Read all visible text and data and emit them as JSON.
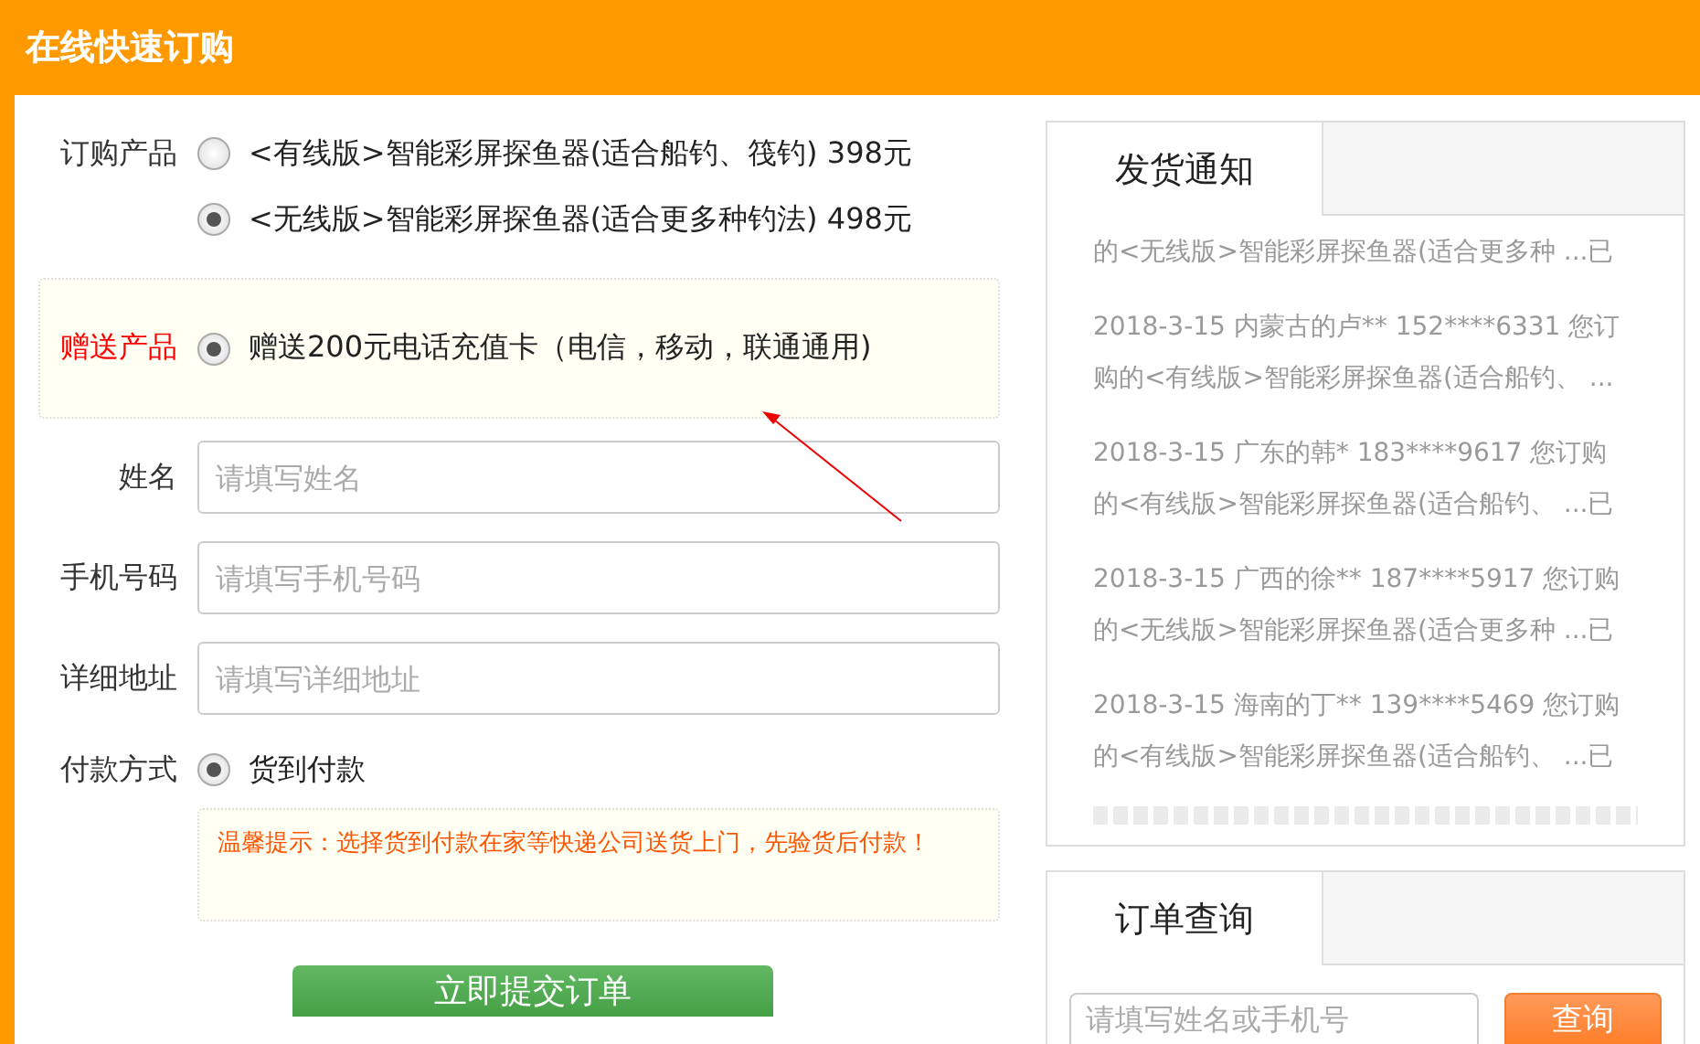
{
  "header": {
    "title": "在线快速订购"
  },
  "form": {
    "product_label": "订购产品",
    "products": [
      {
        "label": "<有线版>智能彩屏探鱼器(适合船钓、筏钓) 398元",
        "selected": false
      },
      {
        "label": "<无线版>智能彩屏探鱼器(适合更多种钓法) 498元",
        "selected": true
      }
    ],
    "gift_label": "赠送产品",
    "gift": {
      "label": "赠送200元电话充值卡（电信，移动，联通通用)",
      "selected": true
    },
    "fields": [
      {
        "label": "姓名",
        "placeholder": "请填写姓名"
      },
      {
        "label": "手机号码",
        "placeholder": "请填写手机号码"
      },
      {
        "label": "详细地址",
        "placeholder": "请填写详细地址"
      }
    ],
    "payment_label": "付款方式",
    "payment": {
      "label": "货到付款",
      "selected": true
    },
    "tip": "温馨提示：选择货到付款在家等快递公司送货上门，先验货后付款！",
    "submit": "立即提交订单"
  },
  "shipping": {
    "tab": "发货通知",
    "notices": [
      {
        "lines": [
          "的<无线版>智能彩屏探鱼器(适合更多种 ...已"
        ]
      },
      {
        "lines": [
          "2018-3-15 内蒙古的卢** 152****6331 您订",
          "购的<有线版>智能彩屏探鱼器(适合船钓、 ..."
        ]
      },
      {
        "lines": [
          "2018-3-15 广东的韩* 183****9617 您订购",
          "的<有线版>智能彩屏探鱼器(适合船钓、 ...已"
        ]
      },
      {
        "lines": [
          "2018-3-15 广西的徐** 187****5917 您订购",
          "的<无线版>智能彩屏探鱼器(适合更多种 ...已"
        ]
      },
      {
        "lines": [
          "2018-3-15 海南的丁** 139****5469 您订购",
          "的<有线版>智能彩屏探鱼器(适合船钓、 ...已"
        ]
      }
    ]
  },
  "query": {
    "tab": "订单查询",
    "placeholder": "请填写姓名或手机号",
    "button": "查询"
  }
}
